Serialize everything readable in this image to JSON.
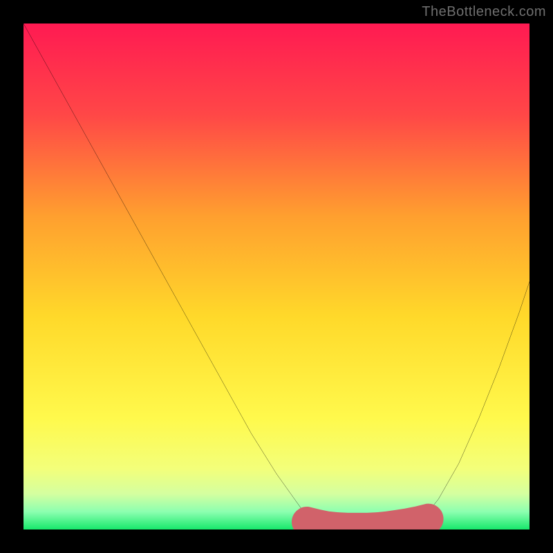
{
  "attribution": "TheBottleneck.com",
  "chart_data": {
    "type": "line",
    "title": "",
    "xlabel": "",
    "ylabel": "",
    "xlim": [
      0,
      100
    ],
    "ylim": [
      0,
      100
    ],
    "grid": false,
    "legend": false,
    "gradient_stops": [
      {
        "offset": 0,
        "color": "#ff1a52"
      },
      {
        "offset": 0.18,
        "color": "#ff4747"
      },
      {
        "offset": 0.38,
        "color": "#ff9f2f"
      },
      {
        "offset": 0.58,
        "color": "#ffd92a"
      },
      {
        "offset": 0.78,
        "color": "#fff94c"
      },
      {
        "offset": 0.88,
        "color": "#f3ff7a"
      },
      {
        "offset": 0.93,
        "color": "#d4ffa0"
      },
      {
        "offset": 0.965,
        "color": "#8cffb0"
      },
      {
        "offset": 1.0,
        "color": "#17e86b"
      }
    ],
    "curve": {
      "name": "bottleneck-curve",
      "color": "#000000",
      "x": [
        0,
        5,
        10,
        15,
        20,
        25,
        30,
        35,
        40,
        45,
        50,
        55,
        58,
        62,
        66,
        70,
        74,
        78,
        82,
        86,
        90,
        94,
        98,
        100
      ],
      "y": [
        100,
        91,
        82,
        73,
        64,
        55,
        46,
        37,
        28,
        19,
        11,
        4,
        1,
        0.2,
        0.1,
        0.1,
        0.2,
        1,
        6,
        13,
        22,
        32,
        43,
        49
      ]
    },
    "marker_band": {
      "name": "optimal-range",
      "color": "#d1626a",
      "x": [
        56,
        58,
        60,
        62,
        64,
        66,
        68,
        70,
        72,
        74,
        76,
        78,
        80
      ],
      "y": [
        1.5,
        1.0,
        0.6,
        0.4,
        0.3,
        0.3,
        0.3,
        0.4,
        0.6,
        0.9,
        1.2,
        1.6,
        2.1
      ]
    },
    "marker_end_dot": {
      "x": 80,
      "y": 2.1,
      "r": 1.3,
      "color": "#d1626a"
    }
  }
}
